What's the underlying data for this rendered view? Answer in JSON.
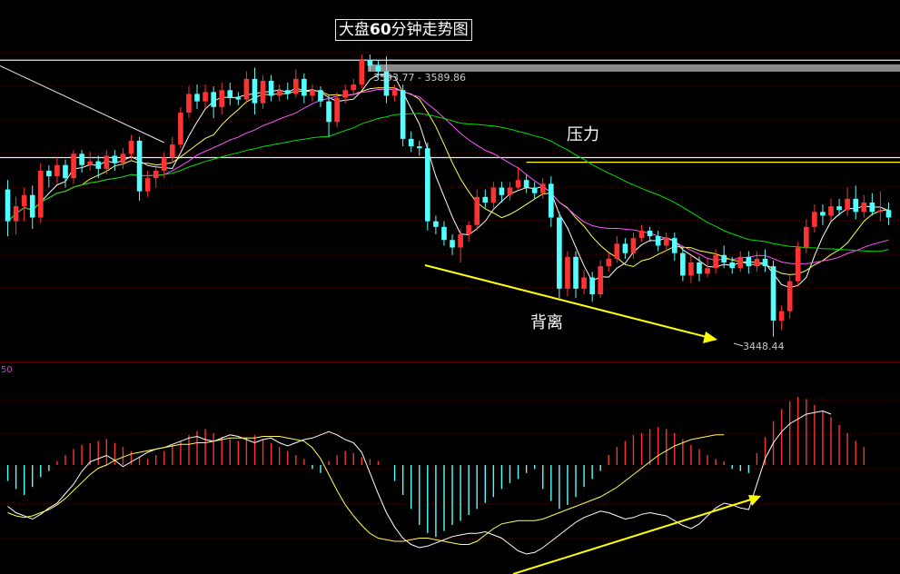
{
  "title_prefix": "大盘",
  "title_number": "60",
  "title_suffix": "分钟走势图",
  "labels": {
    "range": "3593.77 - 3589.86",
    "pressure": "压力",
    "divergence": "背离",
    "low": "3448.44",
    "indicator_value": "50"
  },
  "colors": {
    "background": "#000000",
    "up": "#ff3232",
    "down": "#54ffff",
    "ma_fast": "#ffffff",
    "ma_mid": "#ffff54",
    "ma_slow": "#ff54ff",
    "ma_long": "#00e000",
    "annotation": "#ffff00",
    "grid": "#7a0000"
  },
  "chart_data": [
    {
      "type": "candlestick",
      "title": "大盘60分钟走势图",
      "ylim": [
        3440,
        3600
      ],
      "annotations": [
        "3593.77 - 3589.86",
        "压力",
        "背离",
        "3448.44"
      ],
      "candles": [
        {
          "o": 3527,
          "c": 3510,
          "h": 3532,
          "l": 3502
        },
        {
          "o": 3510,
          "c": 3518,
          "h": 3523,
          "l": 3503
        },
        {
          "o": 3518,
          "c": 3524,
          "h": 3528,
          "l": 3510
        },
        {
          "o": 3524,
          "c": 3512,
          "h": 3529,
          "l": 3506
        },
        {
          "o": 3512,
          "c": 3537,
          "h": 3541,
          "l": 3509
        },
        {
          "o": 3537,
          "c": 3534,
          "h": 3540,
          "l": 3528
        },
        {
          "o": 3534,
          "c": 3540,
          "h": 3544,
          "l": 3530
        },
        {
          "o": 3540,
          "c": 3533,
          "h": 3543,
          "l": 3528
        },
        {
          "o": 3533,
          "c": 3546,
          "h": 3548,
          "l": 3530
        },
        {
          "o": 3546,
          "c": 3540,
          "h": 3548,
          "l": 3536
        },
        {
          "o": 3540,
          "c": 3542,
          "h": 3547,
          "l": 3537
        },
        {
          "o": 3542,
          "c": 3538,
          "h": 3545,
          "l": 3533
        },
        {
          "o": 3538,
          "c": 3545,
          "h": 3548,
          "l": 3535
        },
        {
          "o": 3545,
          "c": 3541,
          "h": 3548,
          "l": 3537
        },
        {
          "o": 3541,
          "c": 3546,
          "h": 3549,
          "l": 3538
        },
        {
          "o": 3546,
          "c": 3553,
          "h": 3556,
          "l": 3543
        },
        {
          "o": 3553,
          "c": 3526,
          "h": 3555,
          "l": 3521
        },
        {
          "o": 3526,
          "c": 3533,
          "h": 3537,
          "l": 3523
        },
        {
          "o": 3533,
          "c": 3537,
          "h": 3540,
          "l": 3528
        },
        {
          "o": 3537,
          "c": 3544,
          "h": 3547,
          "l": 3533
        },
        {
          "o": 3544,
          "c": 3551,
          "h": 3555,
          "l": 3541
        },
        {
          "o": 3551,
          "c": 3568,
          "h": 3571,
          "l": 3549
        },
        {
          "o": 3568,
          "c": 3578,
          "h": 3582,
          "l": 3565
        },
        {
          "o": 3578,
          "c": 3574,
          "h": 3583,
          "l": 3570
        },
        {
          "o": 3574,
          "c": 3579,
          "h": 3583,
          "l": 3570
        },
        {
          "o": 3579,
          "c": 3571,
          "h": 3582,
          "l": 3565
        },
        {
          "o": 3571,
          "c": 3580,
          "h": 3584,
          "l": 3567
        },
        {
          "o": 3580,
          "c": 3576,
          "h": 3584,
          "l": 3572
        },
        {
          "o": 3576,
          "c": 3575,
          "h": 3579,
          "l": 3572
        },
        {
          "o": 3575,
          "c": 3586,
          "h": 3590,
          "l": 3573
        },
        {
          "o": 3586,
          "c": 3573,
          "h": 3592,
          "l": 3567
        },
        {
          "o": 3573,
          "c": 3585,
          "h": 3588,
          "l": 3570
        },
        {
          "o": 3585,
          "c": 3577,
          "h": 3588,
          "l": 3574
        },
        {
          "o": 3577,
          "c": 3580,
          "h": 3583,
          "l": 3574
        },
        {
          "o": 3580,
          "c": 3578,
          "h": 3584,
          "l": 3575
        },
        {
          "o": 3578,
          "c": 3586,
          "h": 3591,
          "l": 3576
        },
        {
          "o": 3586,
          "c": 3577,
          "h": 3589,
          "l": 3573
        },
        {
          "o": 3577,
          "c": 3580,
          "h": 3583,
          "l": 3574
        },
        {
          "o": 3580,
          "c": 3574,
          "h": 3582,
          "l": 3571
        },
        {
          "o": 3574,
          "c": 3563,
          "h": 3577,
          "l": 3555
        },
        {
          "o": 3563,
          "c": 3576,
          "h": 3579,
          "l": 3560
        },
        {
          "o": 3576,
          "c": 3580,
          "h": 3583,
          "l": 3573
        },
        {
          "o": 3580,
          "c": 3583,
          "h": 3586,
          "l": 3577
        },
        {
          "o": 3583,
          "c": 3596,
          "h": 3599,
          "l": 3581
        },
        {
          "o": 3596,
          "c": 3593,
          "h": 3599,
          "l": 3590
        },
        {
          "o": 3593,
          "c": 3590,
          "h": 3596,
          "l": 3587
        },
        {
          "o": 3590,
          "c": 3577,
          "h": 3598,
          "l": 3573
        },
        {
          "o": 3577,
          "c": 3580,
          "h": 3583,
          "l": 3574
        },
        {
          "o": 3580,
          "c": 3554,
          "h": 3583,
          "l": 3550
        },
        {
          "o": 3554,
          "c": 3550,
          "h": 3558,
          "l": 3547
        },
        {
          "o": 3550,
          "c": 3549,
          "h": 3553,
          "l": 3545
        },
        {
          "o": 3549,
          "c": 3510,
          "h": 3552,
          "l": 3505
        },
        {
          "o": 3510,
          "c": 3507,
          "h": 3513,
          "l": 3503
        },
        {
          "o": 3507,
          "c": 3500,
          "h": 3510,
          "l": 3497
        },
        {
          "o": 3500,
          "c": 3496,
          "h": 3503,
          "l": 3492
        },
        {
          "o": 3496,
          "c": 3503,
          "h": 3506,
          "l": 3488
        },
        {
          "o": 3503,
          "c": 3508,
          "h": 3510,
          "l": 3499
        },
        {
          "o": 3508,
          "c": 3523,
          "h": 3527,
          "l": 3505
        },
        {
          "o": 3523,
          "c": 3520,
          "h": 3527,
          "l": 3517
        },
        {
          "o": 3520,
          "c": 3528,
          "h": 3531,
          "l": 3517
        },
        {
          "o": 3528,
          "c": 3524,
          "h": 3531,
          "l": 3520
        },
        {
          "o": 3524,
          "c": 3528,
          "h": 3531,
          "l": 3521
        },
        {
          "o": 3528,
          "c": 3532,
          "h": 3539,
          "l": 3527
        },
        {
          "o": 3532,
          "c": 3528,
          "h": 3535,
          "l": 3525
        },
        {
          "o": 3528,
          "c": 3525,
          "h": 3531,
          "l": 3522
        },
        {
          "o": 3525,
          "c": 3530,
          "h": 3533,
          "l": 3522
        },
        {
          "o": 3530,
          "c": 3512,
          "h": 3534,
          "l": 3507
        },
        {
          "o": 3512,
          "c": 3474,
          "h": 3515,
          "l": 3469
        },
        {
          "o": 3474,
          "c": 3491,
          "h": 3494,
          "l": 3470
        },
        {
          "o": 3491,
          "c": 3474,
          "h": 3494,
          "l": 3469
        },
        {
          "o": 3474,
          "c": 3480,
          "h": 3484,
          "l": 3471
        },
        {
          "o": 3480,
          "c": 3471,
          "h": 3483,
          "l": 3467
        },
        {
          "o": 3471,
          "c": 3486,
          "h": 3489,
          "l": 3469
        },
        {
          "o": 3486,
          "c": 3490,
          "h": 3493,
          "l": 3483
        },
        {
          "o": 3490,
          "c": 3498,
          "h": 3502,
          "l": 3488
        },
        {
          "o": 3498,
          "c": 3493,
          "h": 3501,
          "l": 3490
        },
        {
          "o": 3493,
          "c": 3501,
          "h": 3504,
          "l": 3490
        },
        {
          "o": 3501,
          "c": 3505,
          "h": 3508,
          "l": 3499
        },
        {
          "o": 3505,
          "c": 3502,
          "h": 3507,
          "l": 3499
        },
        {
          "o": 3502,
          "c": 3497,
          "h": 3505,
          "l": 3494
        },
        {
          "o": 3497,
          "c": 3501,
          "h": 3504,
          "l": 3494
        },
        {
          "o": 3501,
          "c": 3493,
          "h": 3504,
          "l": 3489
        },
        {
          "o": 3493,
          "c": 3481,
          "h": 3496,
          "l": 3478
        },
        {
          "o": 3481,
          "c": 3488,
          "h": 3492,
          "l": 3477
        },
        {
          "o": 3488,
          "c": 3482,
          "h": 3491,
          "l": 3478
        },
        {
          "o": 3482,
          "c": 3485,
          "h": 3490,
          "l": 3480
        },
        {
          "o": 3485,
          "c": 3492,
          "h": 3495,
          "l": 3482
        },
        {
          "o": 3492,
          "c": 3488,
          "h": 3497,
          "l": 3485
        },
        {
          "o": 3488,
          "c": 3485,
          "h": 3491,
          "l": 3482
        },
        {
          "o": 3485,
          "c": 3491,
          "h": 3494,
          "l": 3483
        },
        {
          "o": 3491,
          "c": 3486,
          "h": 3494,
          "l": 3482
        },
        {
          "o": 3486,
          "c": 3490,
          "h": 3494,
          "l": 3483
        },
        {
          "o": 3490,
          "c": 3486,
          "h": 3495,
          "l": 3483
        },
        {
          "o": 3486,
          "c": 3457,
          "h": 3489,
          "l": 3448.44
        },
        {
          "o": 3457,
          "c": 3462,
          "h": 3465,
          "l": 3452
        },
        {
          "o": 3462,
          "c": 3478,
          "h": 3481,
          "l": 3458
        },
        {
          "o": 3478,
          "c": 3496,
          "h": 3499,
          "l": 3475
        },
        {
          "o": 3496,
          "c": 3507,
          "h": 3511,
          "l": 3493
        },
        {
          "o": 3507,
          "c": 3515,
          "h": 3519,
          "l": 3504
        },
        {
          "o": 3515,
          "c": 3513,
          "h": 3519,
          "l": 3508
        },
        {
          "o": 3513,
          "c": 3518,
          "h": 3522,
          "l": 3510
        },
        {
          "o": 3518,
          "c": 3516,
          "h": 3522,
          "l": 3513
        },
        {
          "o": 3516,
          "c": 3522,
          "h": 3528,
          "l": 3513
        },
        {
          "o": 3522,
          "c": 3515,
          "h": 3529,
          "l": 3511
        },
        {
          "o": 3515,
          "c": 3520,
          "h": 3524,
          "l": 3512
        },
        {
          "o": 3520,
          "c": 3515,
          "h": 3525,
          "l": 3513
        },
        {
          "o": 3515,
          "c": 3516,
          "h": 3526,
          "l": 3510
        },
        {
          "o": 3516,
          "c": 3512,
          "h": 3520,
          "l": 3508
        }
      ],
      "lines": [
        {
          "kind": "horizontal",
          "y": 3596
        },
        {
          "kind": "band",
          "y1": 3593.77,
          "y2": 3589.86
        },
        {
          "kind": "horizontal",
          "y": 3544
        },
        {
          "kind": "horizontal",
          "y": 3541.5,
          "from_index": 63
        }
      ]
    },
    {
      "type": "macd",
      "macd_bars": [
        -8,
        -12,
        -15,
        -11,
        -6,
        -3,
        2,
        5,
        8,
        10,
        11,
        12,
        13,
        11,
        9,
        7,
        4,
        3,
        5,
        7,
        10,
        12,
        15,
        17,
        18,
        16,
        14,
        13,
        12,
        14,
        15,
        13,
        11,
        9,
        7,
        5,
        3,
        -2,
        -4,
        2,
        5,
        7,
        6,
        4,
        3,
        2,
        0,
        -8,
        -15,
        -22,
        -30,
        -34,
        -36,
        -33,
        -30,
        -28,
        -25,
        -22,
        -19,
        -16,
        -12,
        -9,
        -7,
        -4,
        -2,
        -12,
        -18,
        -22,
        -20,
        -16,
        -11,
        -7,
        -3,
        5,
        9,
        12,
        15,
        16,
        18,
        19,
        18,
        16,
        13,
        10,
        8,
        5,
        3,
        2,
        -2,
        -3,
        -4,
        6,
        14,
        22,
        28,
        32,
        34,
        33,
        30,
        27,
        24,
        20,
        16,
        12,
        9
      ],
      "dif": [
        -26,
        -30,
        -32,
        -34,
        -31,
        -27,
        -24,
        -18,
        -12,
        -4,
        2,
        4,
        6,
        3,
        -1,
        2,
        5,
        8,
        10,
        11,
        13,
        15,
        17,
        18,
        16,
        15,
        17,
        19,
        18,
        16,
        14,
        16,
        17,
        14,
        12,
        14,
        16,
        17,
        19,
        21,
        19,
        16,
        14,
        8,
        -5,
        -18,
        -30,
        -39,
        -46,
        -50,
        -52,
        -51,
        -49,
        -47,
        -45,
        -44,
        -43,
        -43,
        -42,
        -44,
        -46,
        -50,
        -54,
        -56,
        -55,
        -52,
        -48,
        -44,
        -40,
        -36,
        -33,
        -31,
        -29,
        -30,
        -32,
        -34,
        -33,
        -31,
        -30,
        -31,
        -32,
        -35,
        -38,
        -40,
        -37,
        -32,
        -27,
        -24,
        -25,
        -27,
        -28,
        -12,
        4,
        14,
        21,
        26,
        29,
        32,
        33,
        34,
        32
      ],
      "dea": [
        -30,
        -32,
        -33,
        -32,
        -30,
        -28,
        -25,
        -21,
        -16,
        -11,
        -6,
        -2,
        0,
        3,
        5,
        7,
        8,
        9,
        10,
        11,
        12,
        13,
        13,
        14,
        14,
        15,
        16,
        17,
        17,
        17,
        17,
        18,
        18,
        18,
        17,
        16,
        15,
        11,
        4,
        -6,
        -16,
        -25,
        -32,
        -38,
        -43,
        -46,
        -47,
        -48,
        -48,
        -47,
        -46,
        -46,
        -47,
        -48,
        -49,
        -50,
        -50,
        -48,
        -44,
        -40,
        -37,
        -36,
        -35,
        -35,
        -35,
        -34,
        -32,
        -30,
        -28,
        -26,
        -24,
        -22,
        -20,
        -17,
        -14,
        -10,
        -6,
        -2,
        2,
        6,
        9,
        12,
        14,
        16,
        17,
        18,
        19,
        19
      ]
    }
  ]
}
